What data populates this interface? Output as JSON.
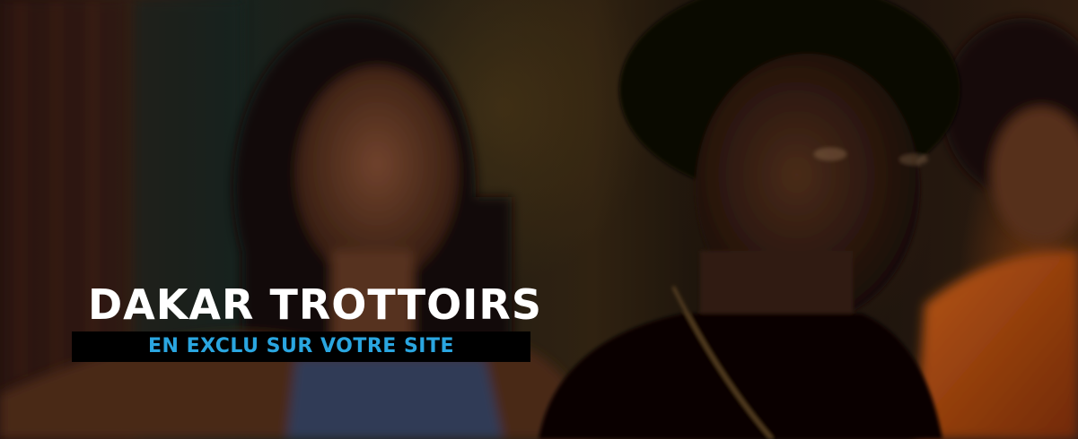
{
  "banner": {
    "title": "DAKAR TROTTOIRS",
    "subtitle": "EN EXCLU SUR VOTRE SITE"
  },
  "colors": {
    "title_text": "#ffffff",
    "subtitle_text": "#2aa6e0",
    "subtitle_background": "#000000"
  }
}
